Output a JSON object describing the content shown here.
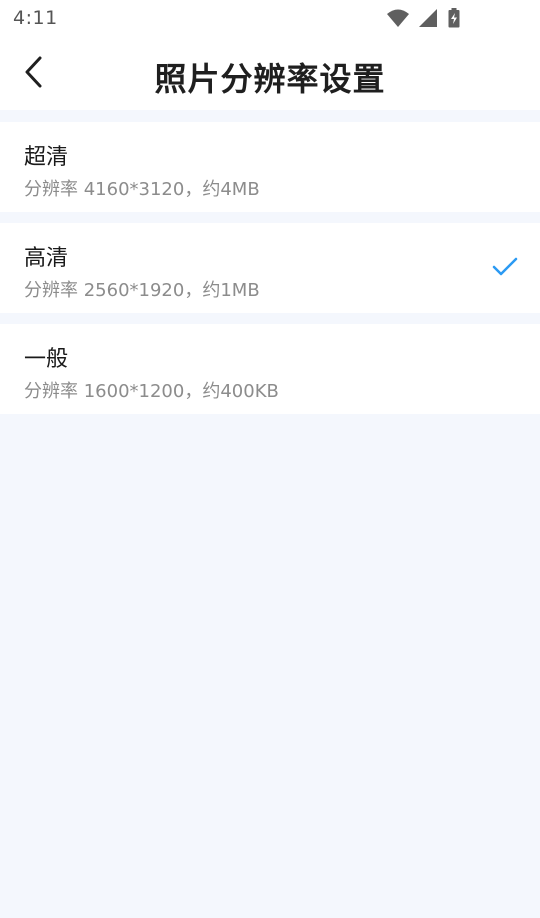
{
  "status_bar": {
    "time": "4:11",
    "icons": [
      "wifi-icon",
      "cellular-signal-icon",
      "battery-charging-icon"
    ]
  },
  "header": {
    "back_icon": "chevron-left-icon",
    "title": "照片分辨率设置"
  },
  "options": [
    {
      "title": "超清",
      "description": "分辨率 4160*3120，约4MB",
      "selected": false
    },
    {
      "title": "高清",
      "description": "分辨率 2560*1920，约1MB",
      "selected": true
    },
    {
      "title": "一般",
      "description": "分辨率 1600*1200，约400KB",
      "selected": false
    }
  ],
  "colors": {
    "page_background": "#f4f7fd",
    "card_background": "#ffffff",
    "accent": "#2b9af3",
    "title_text": "#1f1f1f",
    "secondary_text": "#8c8c8c"
  }
}
